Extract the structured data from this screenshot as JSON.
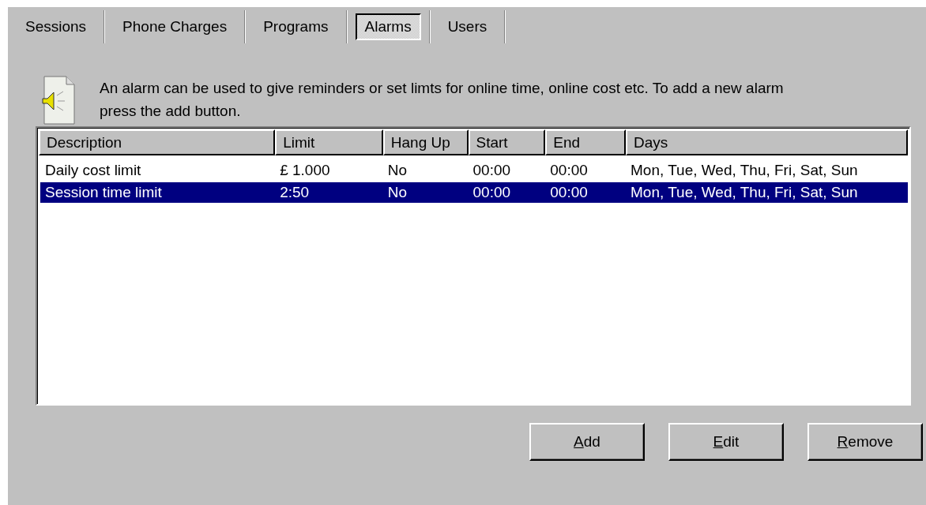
{
  "tabs": [
    {
      "label": "Sessions",
      "selected": false
    },
    {
      "label": "Phone Charges",
      "selected": false
    },
    {
      "label": "Programs",
      "selected": false
    },
    {
      "label": "Alarms",
      "selected": true
    },
    {
      "label": "Users",
      "selected": false
    }
  ],
  "intro": {
    "text": "An alarm can be used to give reminders or set limts for online time, online cost etc. To add a new alarm press the add button."
  },
  "table": {
    "columns": [
      "Description",
      "Limit",
      "Hang Up",
      "Start",
      "End",
      "Days"
    ],
    "rows": [
      {
        "cells": [
          "Daily cost limit",
          "£ 1.000",
          "No",
          "00:00",
          "00:00",
          "Mon, Tue, Wed, Thu, Fri, Sat, Sun"
        ],
        "selected": false
      },
      {
        "cells": [
          "Session time limit",
          "2:50",
          "No",
          "00:00",
          "00:00",
          "Mon, Tue, Wed, Thu, Fri, Sat, Sun"
        ],
        "selected": true
      }
    ]
  },
  "buttons": [
    {
      "access_key": "A",
      "rest": "dd"
    },
    {
      "access_key": "E",
      "rest": "dit"
    },
    {
      "access_key": "R",
      "rest": "emove"
    }
  ]
}
